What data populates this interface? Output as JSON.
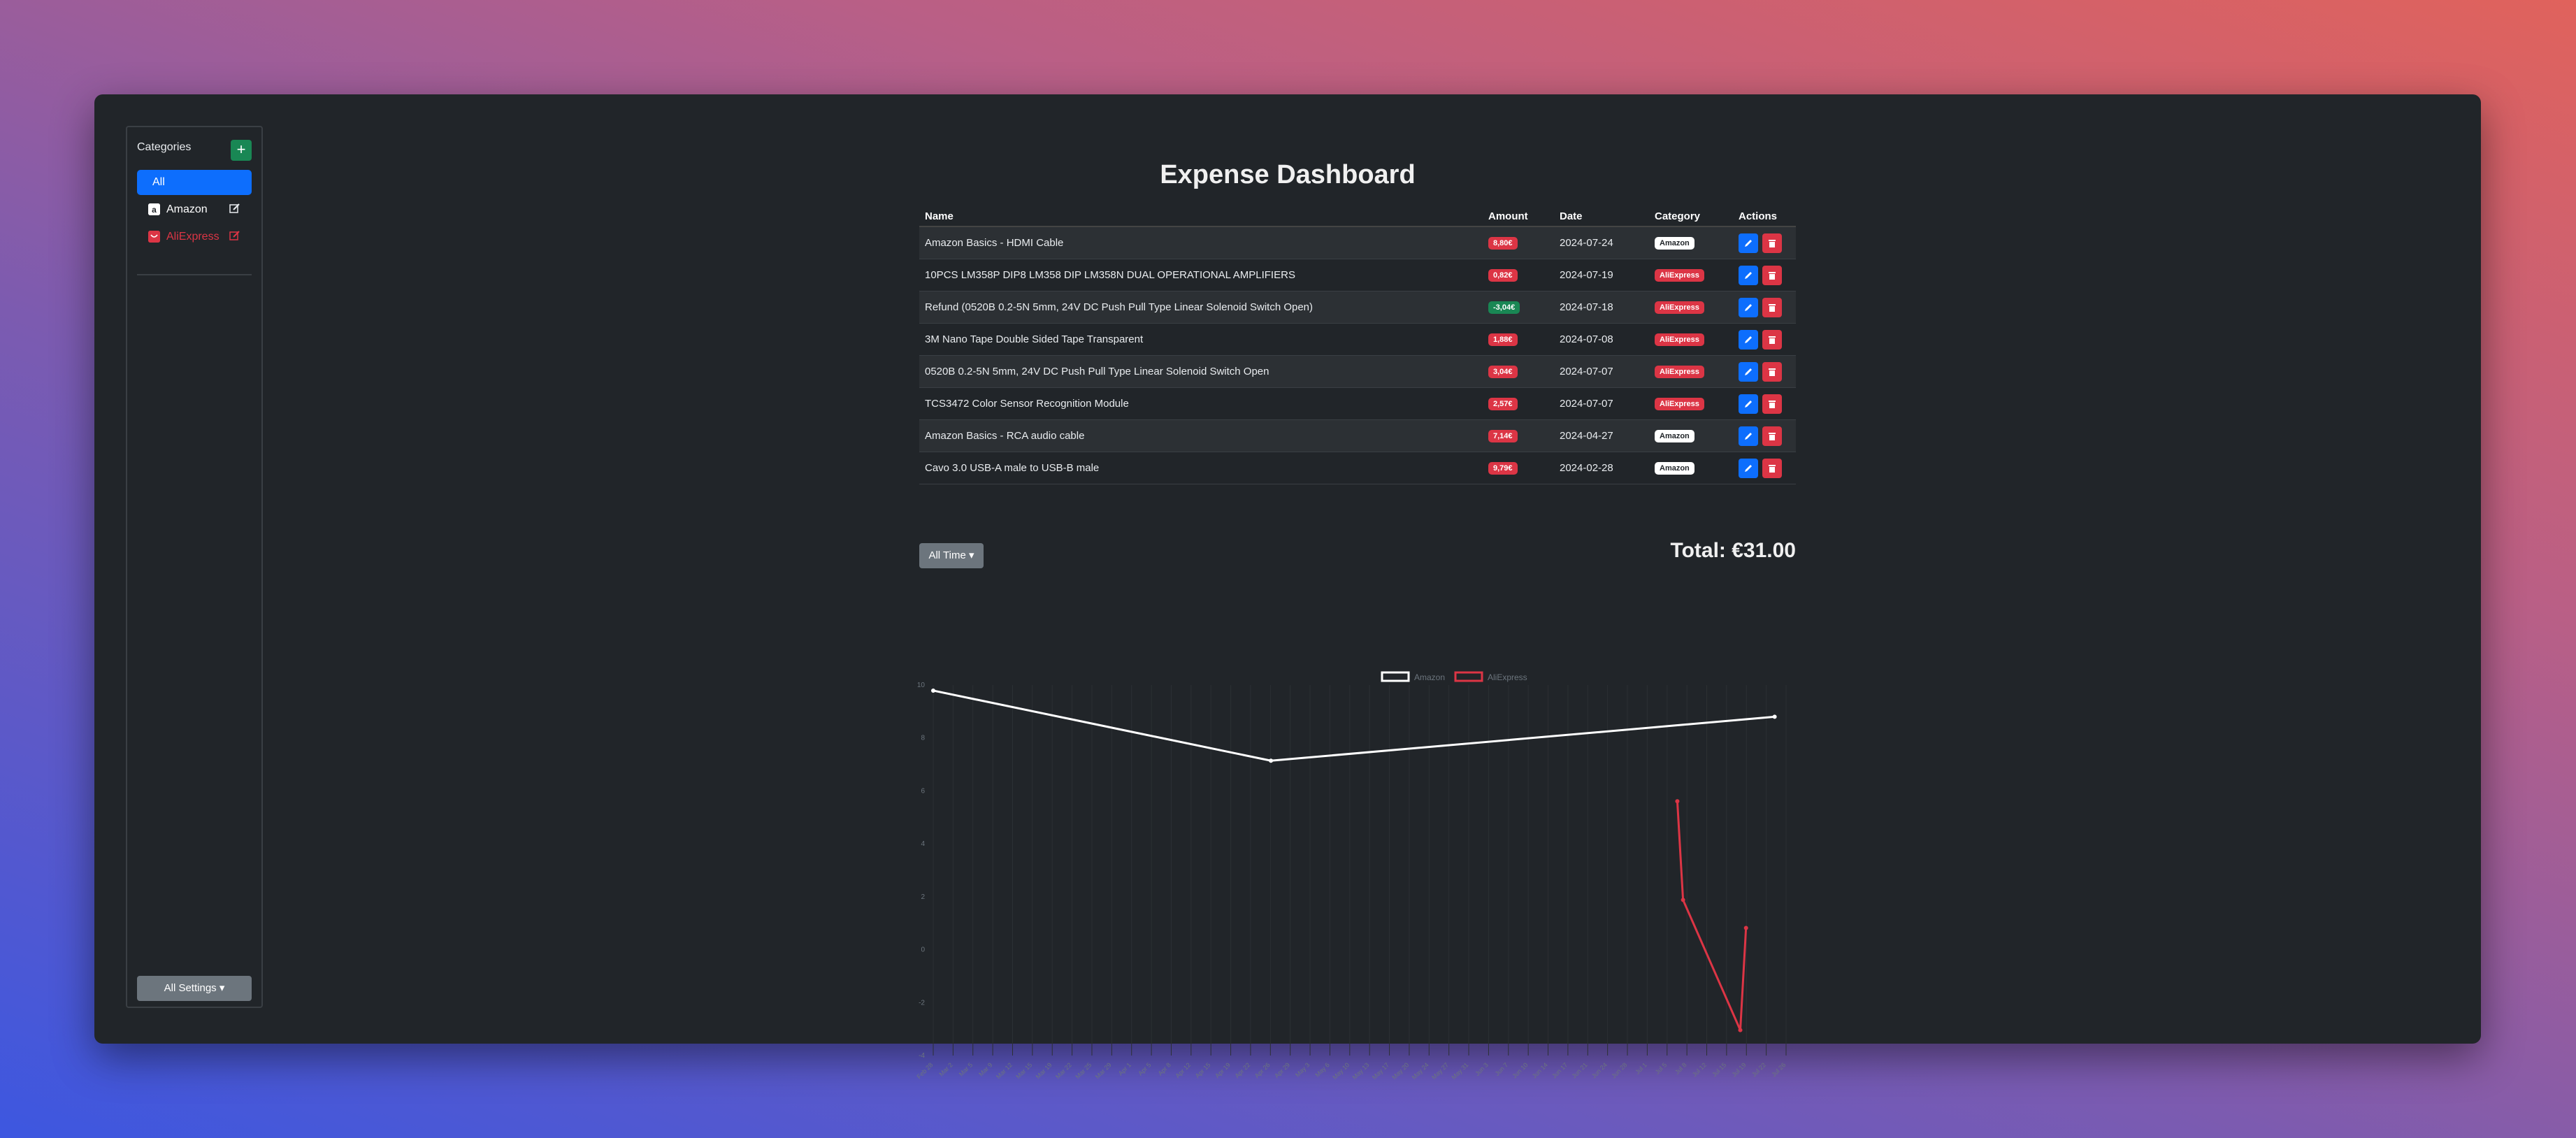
{
  "sidebar": {
    "title": "Categories",
    "add_label": "+",
    "items": [
      {
        "label": "All"
      },
      {
        "label": "Amazon",
        "color": "#ffffff"
      },
      {
        "label": "AliExpress",
        "color": "#dc3545"
      }
    ],
    "settings_label": "All Settings ▾"
  },
  "main": {
    "title": "Expense Dashboard",
    "columns": [
      "Name",
      "Amount",
      "Date",
      "Category",
      "Actions"
    ],
    "rows": [
      {
        "name": "Amazon Basics - HDMI Cable",
        "amount": "8,80€",
        "date": "2024-07-24",
        "category": "Amazon",
        "positive": false
      },
      {
        "name": "10PCS LM358P DIP8 LM358 DIP LM358N DUAL OPERATIONAL AMPLIFIERS",
        "amount": "0,82€",
        "date": "2024-07-19",
        "category": "AliExpress",
        "positive": false
      },
      {
        "name": "Refund (0520B 0.2-5N 5mm, 24V DC Push Pull Type Linear Solenoid Switch Open)",
        "amount": "-3,04€",
        "date": "2024-07-18",
        "category": "AliExpress",
        "positive": true
      },
      {
        "name": "3M Nano Tape Double Sided Tape Transparent",
        "amount": "1,88€",
        "date": "2024-07-08",
        "category": "AliExpress",
        "positive": false
      },
      {
        "name": "0520B 0.2-5N 5mm, 24V DC Push Pull Type Linear Solenoid Switch Open",
        "amount": "3,04€",
        "date": "2024-07-07",
        "category": "AliExpress",
        "positive": false
      },
      {
        "name": "TCS3472 Color Sensor Recognition Module",
        "amount": "2,57€",
        "date": "2024-07-07",
        "category": "AliExpress",
        "positive": false
      },
      {
        "name": "Amazon Basics - RCA audio cable",
        "amount": "7,14€",
        "date": "2024-04-27",
        "category": "Amazon",
        "positive": false
      },
      {
        "name": "Cavo 3.0 USB-A male to USB-B male",
        "amount": "9,79€",
        "date": "2024-02-28",
        "category": "Amazon",
        "positive": false
      }
    ],
    "range_label": "All Time ▾",
    "total": "Total: €31.00"
  },
  "colors": {
    "amazon": "#ffffff",
    "aliexpress": "#dc3545",
    "accent": "#0d6efd",
    "add": "#198754"
  },
  "chart_data": {
    "type": "line",
    "yticks": [
      "10",
      "8",
      "6",
      "4",
      "2",
      "0",
      "-2",
      "-4"
    ],
    "ylim": [
      -4,
      10
    ],
    "x_ticks": [
      "Feb 28",
      "Mar 2",
      "Mar 5",
      "Mar 9",
      "Mar 12",
      "Mar 15",
      "Mar 19",
      "Mar 22",
      "Mar 25",
      "Mar 29",
      "Apr 1",
      "Apr 5",
      "Apr 8",
      "Apr 12",
      "Apr 15",
      "Apr 19",
      "Apr 22",
      "Apr 26",
      "Apr 29",
      "May 3",
      "May 6",
      "May 10",
      "May 13",
      "May 17",
      "May 20",
      "May 24",
      "May 27",
      "May 31",
      "Jun 3",
      "Jun 7",
      "Jun 10",
      "Jun 14",
      "Jun 17",
      "Jun 21",
      "Jun 24",
      "Jun 28",
      "Jul 1",
      "Jul 5",
      "Jul 8",
      "Jul 12",
      "Jul 15",
      "Jul 19",
      "Jul 22",
      "Jul 26"
    ],
    "series": [
      {
        "name": "Amazon",
        "color": "#ffffff",
        "points": [
          [
            "2024-02-28",
            9.79
          ],
          [
            "2024-04-27",
            7.14
          ],
          [
            "2024-07-24",
            8.8
          ]
        ]
      },
      {
        "name": "AliExpress",
        "color": "#dc3545",
        "points": [
          [
            "2024-07-07",
            5.61
          ],
          [
            "2024-07-08",
            1.88
          ],
          [
            "2024-07-18",
            -3.04
          ],
          [
            "2024-07-19",
            0.82
          ]
        ]
      }
    ],
    "legend": "top-center",
    "grid": true
  }
}
